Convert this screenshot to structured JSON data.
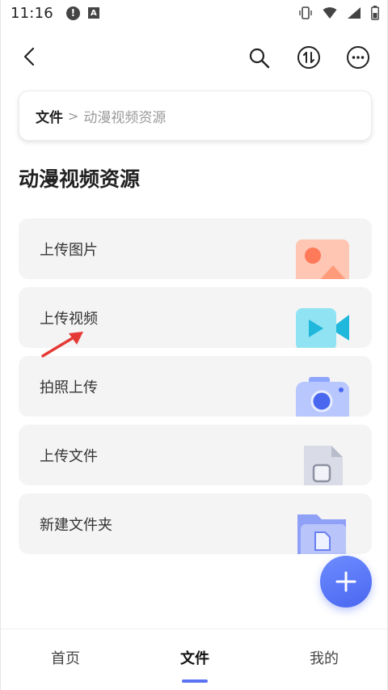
{
  "status_bar": {
    "time": "11:16",
    "alert_glyph": "!",
    "a_badge": "A"
  },
  "header": {
    "icons": [
      "back-icon",
      "search-icon",
      "sort-icon",
      "more-icon"
    ]
  },
  "breadcrumb": {
    "root": "文件",
    "separator": ">",
    "current": "动漫视频资源"
  },
  "page_title": "动漫视频资源",
  "actions": [
    {
      "label": "上传图片",
      "icon": "image-icon"
    },
    {
      "label": "上传视频",
      "icon": "video-icon"
    },
    {
      "label": "拍照上传",
      "icon": "camera-icon"
    },
    {
      "label": "上传文件",
      "icon": "file-icon"
    },
    {
      "label": "新建文件夹",
      "icon": "folder-icon"
    }
  ],
  "fab": {
    "icon": "plus-icon"
  },
  "bottom_nav": {
    "items": [
      {
        "label": "首页",
        "active": false
      },
      {
        "label": "文件",
        "active": true
      },
      {
        "label": "我的",
        "active": false
      }
    ]
  },
  "colors": {
    "accent": "#5a73f2",
    "card_bg": "#f4f4f4",
    "annotation_arrow": "#e53935"
  }
}
